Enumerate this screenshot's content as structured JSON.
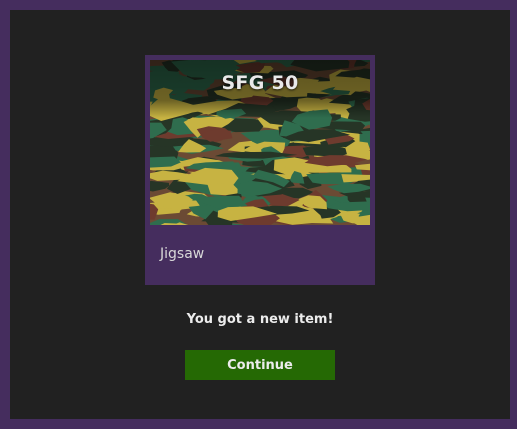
{
  "reward": {
    "weapon_name": "SFG 50",
    "skin_name": "Jigsaw",
    "message": "You got a new item!",
    "continue_label": "Continue"
  },
  "skin_pattern": {
    "name": "camouflage",
    "colors": {
      "base": "#6b4a34",
      "green": "#2f6d4e",
      "dark": "#263526",
      "yellow": "#c7b342",
      "brown": "#6e3b2e"
    }
  },
  "theme": {
    "frame": "#452d5e",
    "panel": "#212121",
    "button": "#256904"
  }
}
